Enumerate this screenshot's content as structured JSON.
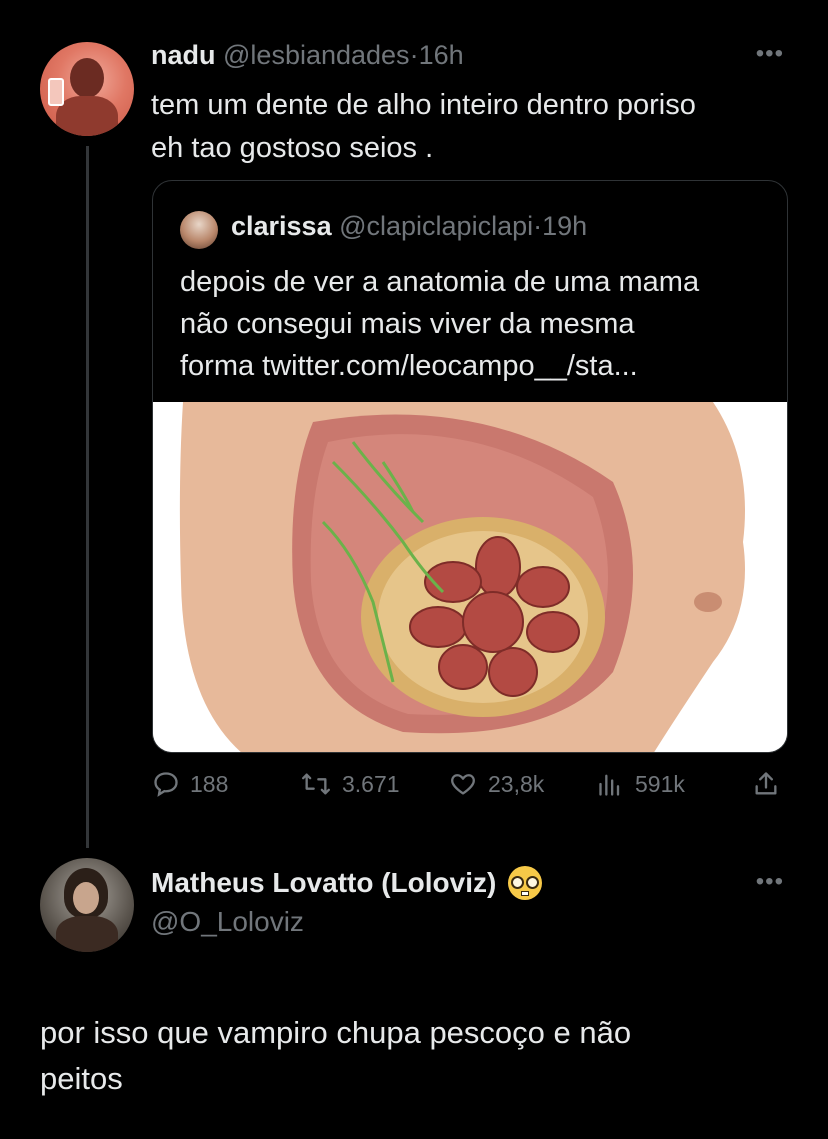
{
  "tweet1": {
    "display_name": "nadu",
    "handle": "@lesbiandades",
    "separator": "·",
    "time": "16h",
    "text_line1": "tem um dente de alho inteiro dentro poriso",
    "text_line2": "eh tao gostoso seios ."
  },
  "quoted": {
    "display_name": "clarissa",
    "handle": "@clapiclapiclapi",
    "separator": "·",
    "time": "19h",
    "text_line1": "depois de ver a anatomia de uma mama",
    "text_line2": "não consegui mais viver da mesma",
    "text_line3": "forma twitter.com/leocampo__/sta..."
  },
  "actions": {
    "replies": "188",
    "retweets": "3.671",
    "likes": "23,8k",
    "views": "591k"
  },
  "tweet2": {
    "display_name": "Matheus Lovatto (Loloviz)",
    "handle": "@O_Loloviz",
    "text_line1": "por isso que vampiro chupa pescoço e não",
    "text_line2": "peitos"
  },
  "icons": {
    "more": "more-icon",
    "reply": "reply-icon",
    "retweet": "retweet-icon",
    "like": "heart-icon",
    "views": "views-icon",
    "share": "share-icon",
    "emoji": "nerd-face-emoji"
  },
  "colors": {
    "background": "#000000",
    "text": "#e7e9ea",
    "muted": "#71767b",
    "border": "#2f3336"
  }
}
